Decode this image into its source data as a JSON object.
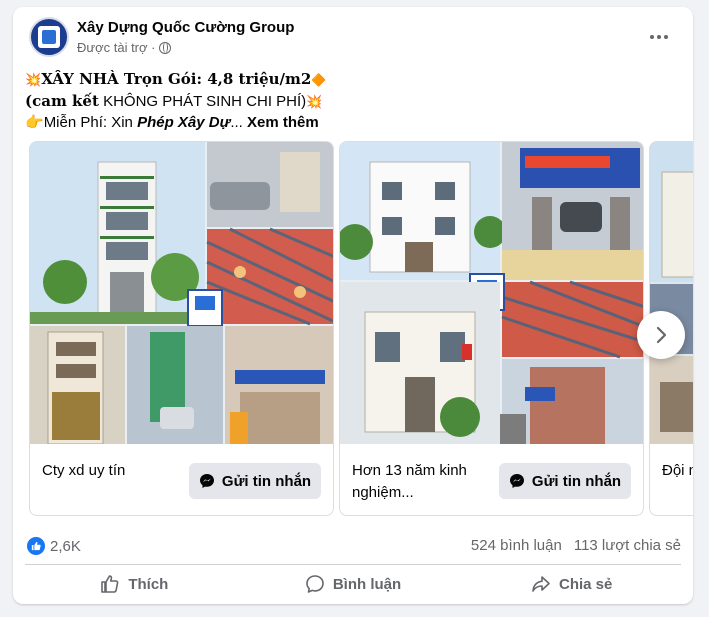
{
  "post": {
    "page_name": "Xây Dựng Quốc Cường Group",
    "sponsored_label": "Được tài trợ ·",
    "text": {
      "line1_prefix_emoji": "💥",
      "line1_bold": "XÂY NHÀ Trọn Gói: 4,8 triệu/m2",
      "line1_suffix_emoji": "🔶",
      "line2_bold": "(cam kết",
      "line2_rest": " KHÔNG PHÁT SINH CHI PHÍ)",
      "line2_emoji": "💥",
      "line3_emoji": "👉",
      "line3_text": "Miễn Phí: Xin ",
      "line3_italic": "Phép Xây Dự",
      "line3_ellipsis": "... ",
      "see_more": "Xem thêm"
    }
  },
  "carousel": {
    "cards": [
      {
        "caption": "Cty xd uy tín",
        "button_label": "Gửi tin nhắn"
      },
      {
        "caption": "Hơn 13 năm kinh nghiệm...",
        "button_label": "Gửi tin nhắn"
      },
      {
        "caption": "Đội n trình"
      }
    ]
  },
  "engagement": {
    "reaction_count": "2,6K",
    "comments": "524 bình luận",
    "shares": "113 lượt chia sẻ"
  },
  "actions": {
    "like": "Thích",
    "comment": "Bình luận",
    "share": "Chia sẻ"
  },
  "colors": {
    "accent": "#1877f2",
    "secondary_text": "#65676b",
    "button_bg": "#e4e6eb",
    "page_bg": "#f0f2f5"
  },
  "icons": {
    "more": "more-horizontal-icon",
    "globe": "globe-icon",
    "messenger": "messenger-icon",
    "next": "chevron-right-icon",
    "like": "thumbs-up-icon",
    "comment": "comment-icon",
    "share": "share-icon"
  }
}
